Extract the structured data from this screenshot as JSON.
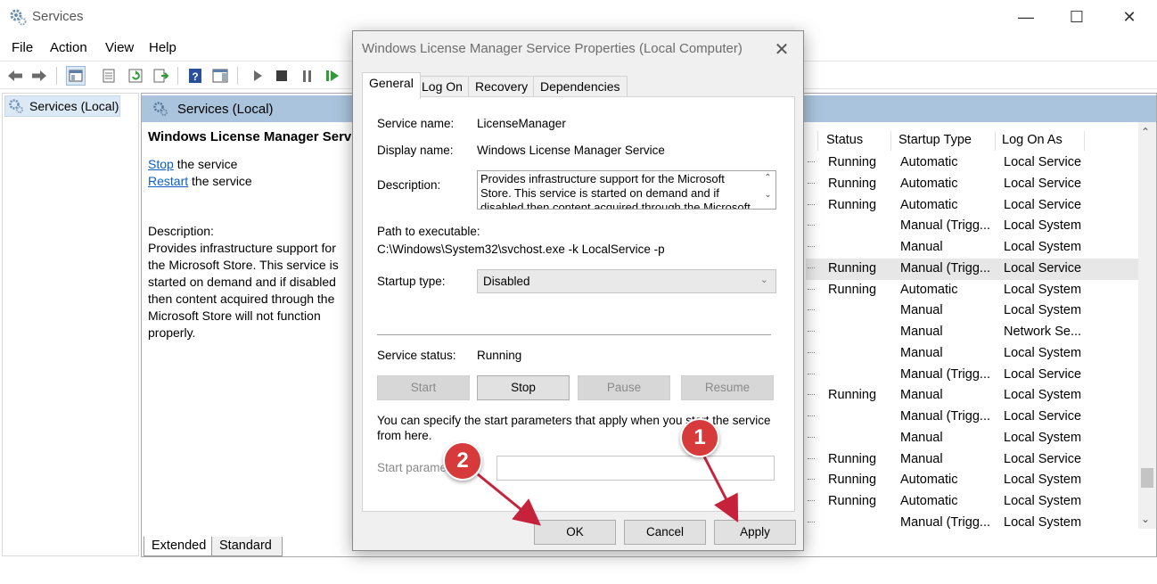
{
  "window": {
    "title": "Services",
    "controls": {
      "minimize": "—",
      "maximize": "☐",
      "close": "✕"
    }
  },
  "menu": [
    "File",
    "Action",
    "View",
    "Help"
  ],
  "toolbar_icons": [
    "back-arrow-icon",
    "forward-arrow-icon",
    "console-tree-icon",
    "properties-icon",
    "refresh-icon",
    "export-list-icon",
    "help-icon",
    "show-hide-action-pane-icon",
    "start-service-icon",
    "stop-service-icon",
    "pause-service-icon",
    "restart-service-icon"
  ],
  "tree": {
    "node_label": "Services (Local)"
  },
  "pane": {
    "header": "Services (Local)",
    "service_title": "Windows License Manager Service",
    "stop_link": "Stop",
    "stop_suffix": " the service",
    "restart_link": "Restart",
    "restart_suffix": " the service",
    "description_label": "Description:",
    "description_lines": [
      "Provides infrastructure support for",
      "the Microsoft Store.  This service is",
      "started on demand and if disabled",
      "then content acquired through the",
      "Microsoft Store will not function",
      "properly."
    ]
  },
  "table": {
    "columns": [
      "Status",
      "Startup Type",
      "Log On As"
    ],
    "rows": [
      {
        "status": "Running",
        "startup": "Automatic",
        "logon": "Local Service",
        "selected": false
      },
      {
        "status": "Running",
        "startup": "Automatic",
        "logon": "Local Service",
        "selected": false
      },
      {
        "status": "Running",
        "startup": "Automatic",
        "logon": "Local Service",
        "selected": false
      },
      {
        "status": "",
        "startup": "Manual (Trigg...",
        "logon": "Local System",
        "selected": false
      },
      {
        "status": "",
        "startup": "Manual",
        "logon": "Local System",
        "selected": false
      },
      {
        "status": "Running",
        "startup": "Manual (Trigg...",
        "logon": "Local Service",
        "selected": true
      },
      {
        "status": "Running",
        "startup": "Automatic",
        "logon": "Local System",
        "selected": false
      },
      {
        "status": "",
        "startup": "Manual",
        "logon": "Local System",
        "selected": false
      },
      {
        "status": "",
        "startup": "Manual",
        "logon": "Network Se...",
        "selected": false
      },
      {
        "status": "",
        "startup": "Manual",
        "logon": "Local System",
        "selected": false
      },
      {
        "status": "",
        "startup": "Manual (Trigg...",
        "logon": "Local Service",
        "selected": false
      },
      {
        "status": "Running",
        "startup": "Manual",
        "logon": "Local System",
        "selected": false
      },
      {
        "status": "",
        "startup": "Manual (Trigg...",
        "logon": "Local Service",
        "selected": false
      },
      {
        "status": "",
        "startup": "Manual",
        "logon": "Local System",
        "selected": false
      },
      {
        "status": "Running",
        "startup": "Manual",
        "logon": "Local Service",
        "selected": false
      },
      {
        "status": "Running",
        "startup": "Automatic",
        "logon": "Local System",
        "selected": false
      },
      {
        "status": "Running",
        "startup": "Automatic",
        "logon": "Local System",
        "selected": false
      },
      {
        "status": "",
        "startup": "Manual (Trigg...",
        "logon": "Local System",
        "selected": false
      }
    ]
  },
  "bottom_tabs": [
    "Extended",
    "Standard"
  ],
  "dialog": {
    "title": "Windows License Manager Service Properties (Local Computer)",
    "close": "✕",
    "tabs": [
      "General",
      "Log On",
      "Recovery",
      "Dependencies"
    ],
    "active_tab": "General",
    "service_name_label": "Service name:",
    "service_name": "LicenseManager",
    "display_name_label": "Display name:",
    "display_name": "Windows License Manager Service",
    "description_label": "Description:",
    "description": "Provides infrastructure support for the Microsoft Store.  This service is started on demand and if disabled then content acquired through the Microsoft",
    "path_label": "Path to executable:",
    "path": "C:\\Windows\\System32\\svchost.exe -k LocalService -p",
    "startup_label": "Startup type:",
    "startup_value": "Disabled",
    "status_label": "Service status:",
    "status_value": "Running",
    "buttons": {
      "start": "Start",
      "stop": "Stop",
      "pause": "Pause",
      "resume": "Resume"
    },
    "hint": "You can specify the start parameters that apply when you start the service from here.",
    "param_label": "Start parameters:",
    "param_value": "",
    "ok": "OK",
    "cancel": "Cancel",
    "apply": "Apply"
  },
  "annotations": [
    {
      "label": "1",
      "color": "#d63a3a"
    },
    {
      "label": "2",
      "color": "#d63a3a"
    }
  ]
}
